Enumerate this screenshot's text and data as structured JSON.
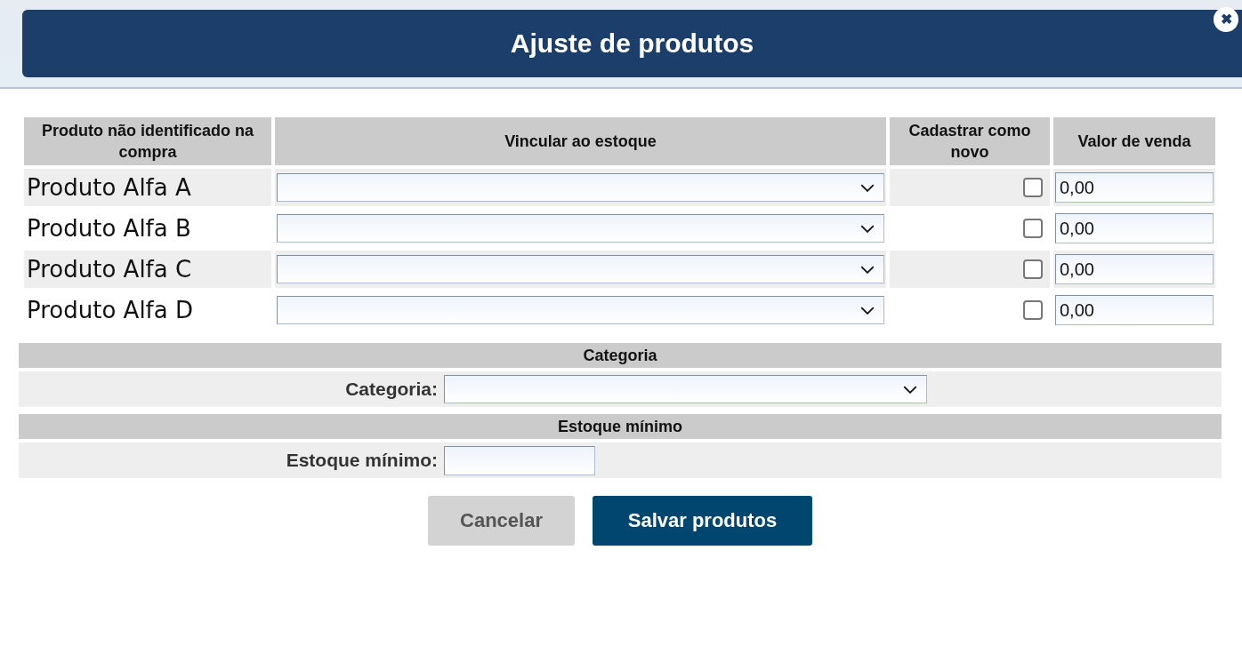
{
  "dialog": {
    "title": "Ajuste de produtos",
    "close_icon": "✖"
  },
  "table": {
    "columns": [
      "Produto não identificado na compra",
      "Vincular ao estoque",
      "Cadastrar como novo",
      "Valor de venda"
    ],
    "rows": [
      {
        "name": "Produto Alfa A",
        "checked": false,
        "value": "0,00"
      },
      {
        "name": "Produto Alfa B",
        "checked": false,
        "value": "0,00"
      },
      {
        "name": "Produto Alfa C",
        "checked": false,
        "value": "0,00"
      },
      {
        "name": "Produto Alfa D",
        "checked": false,
        "value": "0,00"
      }
    ]
  },
  "sections": [
    {
      "kind": "select",
      "header": "Categoria",
      "label": "Categoria:"
    },
    {
      "kind": "input",
      "header": "Estoque mínimo",
      "label": "Estoque mínimo:"
    }
  ],
  "buttons": [
    {
      "label": "Cancelar",
      "kind": "secondary"
    },
    {
      "label": "Salvar produtos",
      "kind": "primary"
    }
  ]
}
